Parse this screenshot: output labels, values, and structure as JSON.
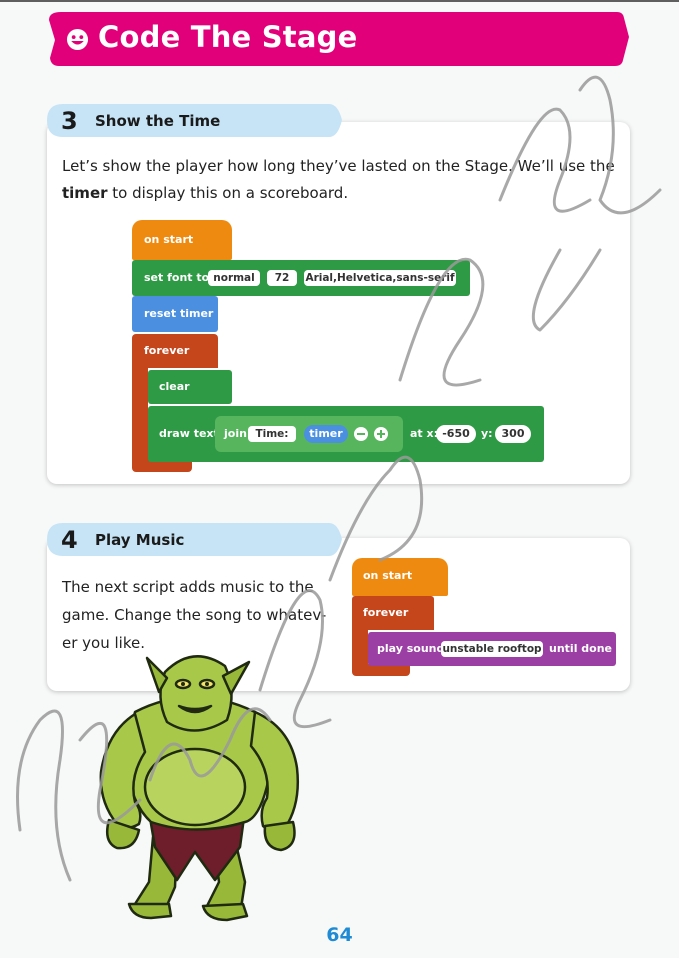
{
  "header": {
    "title": "Code The Stage",
    "icon": "smiley-icon",
    "color": "#e2007a"
  },
  "section3": {
    "number": "3",
    "title": "Show the Time",
    "para_part1": "Let’s show the player how long they’ve lasted on the Stage. We’ll use the",
    "para_bold": "timer",
    "para_part2": "to display this on a scoreboard.",
    "code": {
      "on_start": "on start",
      "set_font": "set font to",
      "font_style": "normal",
      "font_size": "72",
      "font_family": "Arial,Helvetica,sans-serif",
      "reset_timer": "reset timer",
      "forever": "forever",
      "clear": "clear",
      "draw_text": "draw text",
      "join": "join",
      "join_text": "Time:",
      "timer": "timer",
      "at_x": "at x:",
      "x_value": "-650",
      "y_label": "y:",
      "y_value": "300"
    }
  },
  "section4": {
    "number": "4",
    "title": "Play Music",
    "para_line1": "The next script adds music to the",
    "para_line2": "game. Change the song to whatev-",
    "para_line3": "er you like.",
    "code": {
      "on_start": "on start",
      "forever": "forever",
      "play_sound": "play sound",
      "sound_name": "unstable rooftop",
      "until_done": "until done"
    }
  },
  "page_number": "64",
  "colors": {
    "orange": "#ef8a10",
    "green": "#2f9a45",
    "blue": "#4b8fe0",
    "rust": "#c6461c",
    "purple": "#9b3fa5",
    "light_blue_tab": "#c6e4f6",
    "page_number": "#1e8bd4"
  }
}
